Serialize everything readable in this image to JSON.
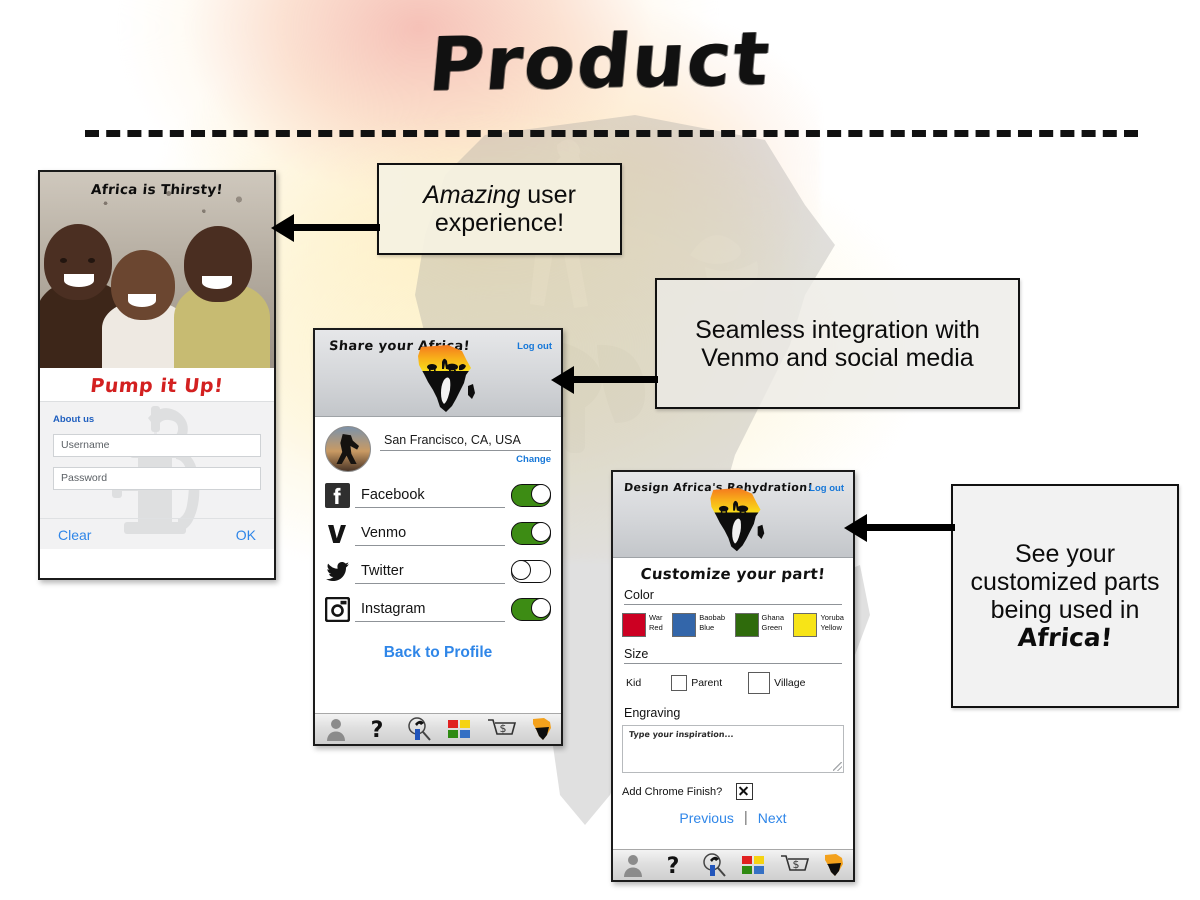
{
  "slide": {
    "title": "Product"
  },
  "callouts": [
    {
      "id": "ux",
      "emphasis": "Amazing",
      "rest": " user experience!"
    },
    {
      "id": "venmo",
      "text": "Seamless integration with Venmo and social media"
    },
    {
      "id": "africa",
      "lead": "See your customized parts being used in ",
      "accent": "Africa!"
    }
  ],
  "phone_login": {
    "hero_title": "Africa is Thirsty!",
    "pump_title": "Pump it Up!",
    "about_link": "About us",
    "username_placeholder": "Username",
    "password_placeholder": "Password",
    "clear_label": "Clear",
    "ok_label": "OK"
  },
  "phone_share": {
    "header_title": "Share your Africa!",
    "logout_label": "Log out",
    "location": "San Francisco, CA, USA",
    "change_label": "Change",
    "social": [
      {
        "name": "Facebook",
        "icon": "facebook-icon",
        "enabled": true,
        "state": "on"
      },
      {
        "name": "Venmo",
        "icon": "venmo-icon",
        "enabled": true,
        "state": "on"
      },
      {
        "name": "Twitter",
        "icon": "twitter-icon",
        "enabled": false,
        "state": "off"
      },
      {
        "name": "Instagram",
        "icon": "instagram-icon",
        "enabled": true,
        "state": "on"
      }
    ],
    "back_link": "Back to Profile"
  },
  "phone_design": {
    "header_title": "Design Africa's Rehydration!",
    "logout_label": "Log out",
    "section_title": "Customize your part!",
    "color_label": "Color",
    "colors": [
      {
        "name": "War Red",
        "line1": "War",
        "line2": "Red",
        "hex": "#cc0022"
      },
      {
        "name": "Baobab Blue",
        "line1": "Baobab",
        "line2": "Blue",
        "hex": "#3366aa"
      },
      {
        "name": "Ghana Green",
        "line1": "Ghana",
        "line2": "Green",
        "hex": "#2f6b0c"
      },
      {
        "name": "Yoruba Yellow",
        "line1": "Yoruba",
        "line2": "Yellow",
        "hex": "#f7e417"
      }
    ],
    "size_label": "Size",
    "sizes": [
      {
        "name": "Kid",
        "selected": false
      },
      {
        "name": "Parent",
        "selected": false
      },
      {
        "name": "Village",
        "selected": false
      }
    ],
    "engraving_label": "Engraving",
    "engraving_placeholder": "Type your inspiration...",
    "chrome_label": "Add Chrome Finish?",
    "chrome_checked": true,
    "previous_label": "Previous",
    "separator": "|",
    "next_label": "Next"
  },
  "tabbar": {
    "items": [
      {
        "icon": "profile-icon",
        "name": "profile"
      },
      {
        "icon": "help-icon",
        "name": "help"
      },
      {
        "icon": "pump-icon",
        "name": "pump"
      },
      {
        "icon": "colors-icon",
        "name": "colors"
      },
      {
        "icon": "cart-icon",
        "name": "cart"
      },
      {
        "icon": "africa-icon",
        "name": "africa"
      }
    ]
  },
  "palette": {
    "link_blue": "#2f86e8",
    "toggle_green": "#3d8c14",
    "pump_red": "#d32020",
    "logo_orange": "#f0951e",
    "logo_yellow": "#f7cf1c"
  }
}
